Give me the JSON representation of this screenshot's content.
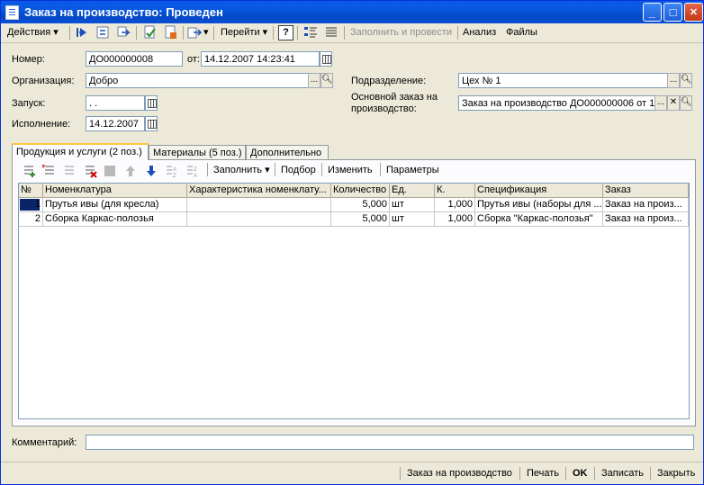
{
  "window": {
    "title": "Заказ на производство: Проведен",
    "minimize": "_",
    "maximize": "□",
    "close": "✕"
  },
  "toolbar": {
    "actions": "Действия",
    "goto": "Перейти",
    "help": "?",
    "fill_and_post": "Заполнить и провести",
    "analysis": "Анализ",
    "files": "Файлы"
  },
  "form": {
    "number_label": "Номер:",
    "number_value": "ДО000000008",
    "from_label": "от:",
    "date_value": "14.12.2007 14:23:41",
    "org_label": "Организация:",
    "org_value": "Добро",
    "launch_label": "Запуск:",
    "launch_value": " .  .",
    "exec_label": "Исполнение:",
    "exec_value": "14.12.2007",
    "division_label": "Подразделение:",
    "division_value": "Цех № 1",
    "base_order_label_1": "Основной заказ на",
    "base_order_label_2": "производство:",
    "base_order_value": "Заказ на производство ДО000000006 от 1"
  },
  "tabs": [
    {
      "label": "Продукция и услуги (2 поз.)"
    },
    {
      "label": "Материалы (5 поз.)"
    },
    {
      "label": "Дополнительно"
    }
  ],
  "table_toolbar": {
    "fill": "Заполнить",
    "selection": "Подбор",
    "change": "Изменить",
    "params": "Параметры"
  },
  "table": {
    "columns": [
      "№",
      "Номенклатура",
      "Характеристика номенклату...",
      "Количество",
      "Ед.",
      "К.",
      "Спецификация",
      "Заказ"
    ],
    "rows": [
      {
        "n": "1",
        "item": "Прутья ивы (для кресла)",
        "char": "",
        "qty": "5,000",
        "unit": "шт",
        "k": "1,000",
        "spec": "Прутья ивы (наборы для ...",
        "order": "Заказ на произ..."
      },
      {
        "n": "2",
        "item": "Сборка Каркас-полозья",
        "char": "",
        "qty": "5,000",
        "unit": "шт",
        "k": "1,000",
        "spec": "Сборка \"Каркас-полозья\"",
        "order": "Заказ на произ..."
      }
    ]
  },
  "comment": {
    "label": "Комментарий:",
    "value": ""
  },
  "bottom": {
    "order": "Заказ на производство",
    "print": "Печать",
    "ok": "OK",
    "save": "Записать",
    "close": "Закрыть"
  }
}
